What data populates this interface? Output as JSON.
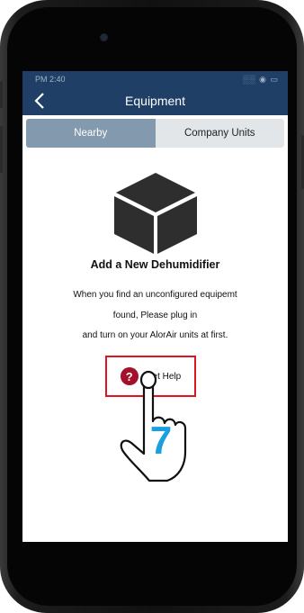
{
  "status_bar": {
    "time": "PM 2:40",
    "icons": "░░ ◉ ▭"
  },
  "header": {
    "title": "Equipment",
    "back_icon": "chevron-left-icon"
  },
  "tabs": [
    {
      "label": "Nearby",
      "active": true
    },
    {
      "label": "Company Units",
      "active": false
    }
  ],
  "main": {
    "icon": "cube-icon",
    "heading": "Add a New Dehumidifier",
    "description_lines": [
      "When you find an unconfigured equipemt",
      "found, Please plug in",
      "and turn on your AlorAir units at first."
    ],
    "help_button": {
      "label": "Get Help",
      "icon": "question-icon",
      "icon_glyph": "?"
    }
  },
  "annotation": {
    "step_number": "7",
    "icon": "pointing-hand-icon"
  },
  "colors": {
    "header_bg": "#1f3f66",
    "tab_active_bg": "#8299ae",
    "tab_inactive_bg": "#e3e6e8",
    "highlight_border": "#e0141e",
    "help_icon_bg": "#a3122a",
    "step_number": "#1aa0e0"
  }
}
